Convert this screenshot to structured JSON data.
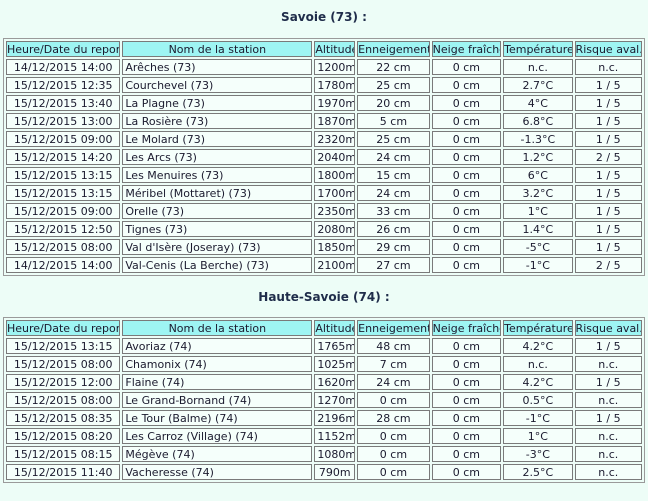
{
  "headers": [
    "Heure/Date du report",
    "Nom de la station",
    "Altitude",
    "Enneigement",
    "Neige fraîche",
    "Température",
    "Risque aval."
  ],
  "sections": [
    {
      "title": "Savoie (73) :",
      "rows": [
        [
          "14/12/2015 14:00",
          "Arêches (73)",
          "1200m",
          "22 cm",
          "0 cm",
          "n.c.",
          "n.c."
        ],
        [
          "15/12/2015 12:35",
          "Courchevel (73)",
          "1780m",
          "25 cm",
          "0 cm",
          "2.7°C",
          "1 / 5"
        ],
        [
          "15/12/2015 13:40",
          "La Plagne (73)",
          "1970m",
          "20 cm",
          "0 cm",
          "4°C",
          "1 / 5"
        ],
        [
          "15/12/2015 13:00",
          "La Rosière (73)",
          "1870m",
          "5 cm",
          "0 cm",
          "6.8°C",
          "1 / 5"
        ],
        [
          "15/12/2015 09:00",
          "Le Molard (73)",
          "2320m",
          "25 cm",
          "0 cm",
          "-1.3°C",
          "1 / 5"
        ],
        [
          "15/12/2015 14:20",
          "Les Arcs (73)",
          "2040m",
          "24 cm",
          "0 cm",
          "1.2°C",
          "2 / 5"
        ],
        [
          "15/12/2015 13:15",
          "Les Menuires (73)",
          "1800m",
          "15 cm",
          "0 cm",
          "6°C",
          "1 / 5"
        ],
        [
          "15/12/2015 13:15",
          "Méribel (Mottaret) (73)",
          "1700m",
          "24 cm",
          "0 cm",
          "3.2°C",
          "1 / 5"
        ],
        [
          "15/12/2015 09:00",
          "Orelle (73)",
          "2350m",
          "33 cm",
          "0 cm",
          "1°C",
          "1 / 5"
        ],
        [
          "15/12/2015 12:50",
          "Tignes (73)",
          "2080m",
          "26 cm",
          "0 cm",
          "1.4°C",
          "1 / 5"
        ],
        [
          "15/12/2015 08:00",
          "Val d'Isère (Joseray) (73)",
          "1850m",
          "29 cm",
          "0 cm",
          "-5°C",
          "1 / 5"
        ],
        [
          "14/12/2015 14:00",
          "Val-Cenis (La Berche) (73)",
          "2100m",
          "27 cm",
          "0 cm",
          "-1°C",
          "2 / 5"
        ]
      ]
    },
    {
      "title": "Haute-Savoie (74) :",
      "rows": [
        [
          "15/12/2015 13:15",
          "Avoriaz (74)",
          "1765m",
          "48 cm",
          "0 cm",
          "4.2°C",
          "1 / 5"
        ],
        [
          "15/12/2015 08:00",
          "Chamonix (74)",
          "1025m",
          "7 cm",
          "0 cm",
          "n.c.",
          "n.c."
        ],
        [
          "15/12/2015 12:00",
          "Flaine (74)",
          "1620m",
          "24 cm",
          "0 cm",
          "4.2°C",
          "1 / 5"
        ],
        [
          "15/12/2015 08:00",
          "Le Grand-Bornand (74)",
          "1270m",
          "0 cm",
          "0 cm",
          "0.5°C",
          "n.c."
        ],
        [
          "15/12/2015 08:35",
          "Le Tour (Balme) (74)",
          "2196m",
          "28 cm",
          "0 cm",
          "-1°C",
          "1 / 5"
        ],
        [
          "15/12/2015 08:20",
          "Les Carroz (Village) (74)",
          "1152m",
          "0 cm",
          "0 cm",
          "1°C",
          "n.c."
        ],
        [
          "15/12/2015 08:15",
          "Mégève (74)",
          "1080m",
          "0 cm",
          "0 cm",
          "-3°C",
          "n.c."
        ],
        [
          "15/12/2015 11:40",
          "Vacheresse (74)",
          "790m",
          "0 cm",
          "0 cm",
          "2.5°C",
          "n.c."
        ]
      ]
    }
  ]
}
